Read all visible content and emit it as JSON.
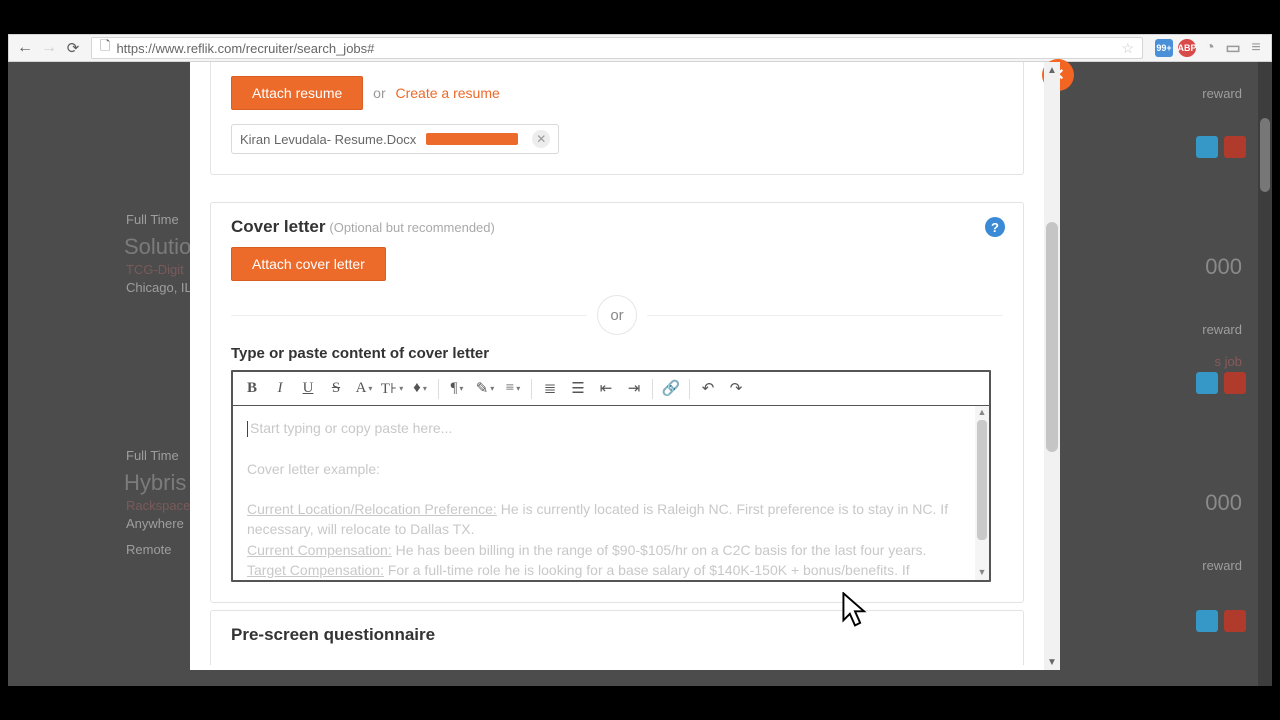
{
  "browser": {
    "url": "https://www.reflik.com/recruiter/search_jobs#"
  },
  "bg": {
    "full_time": "Full Time",
    "job1_title": "Solutio",
    "job1_company": "TCG-Digit",
    "job1_loc": "Chicago, IL",
    "job2_title": "Hybris",
    "job2_company": "Rackspace",
    "job2_loc": "Anywhere",
    "remote": "Remote",
    "reward": "reward",
    "job": "s job",
    "amount": "000"
  },
  "resume": {
    "attach_btn": "Attach resume",
    "or": "or",
    "create_link": "Create a resume",
    "file_name": "Kiran Levudala- Resume.Docx"
  },
  "cover": {
    "title": "Cover letter",
    "subtitle": "(Optional but recommended)",
    "attach_btn": "Attach cover letter",
    "or_label": "or",
    "type_label": "Type or paste content of cover letter",
    "placeholder_line1": "Start typing or copy paste here...",
    "example_heading": "Cover letter example:",
    "ex1_label": "Current Location/Relocation Preference:",
    "ex1_text": " He is currently located is Raleigh NC. First preference is to stay in NC. If necessary, will relocate to Dallas TX.",
    "ex2_label": "Current Compensation:",
    "ex2_text": " He has been billing in the range of $90-$105/hr on a C2C basis for the last four years.",
    "ex3_label": "Target Compensation:",
    "ex3_text": " For a full-time role he is looking for a base salary of $140K-150K + bonus/benefits. If relocating, some assistance."
  },
  "prescreen": {
    "title": "Pre-screen questionnaire"
  }
}
